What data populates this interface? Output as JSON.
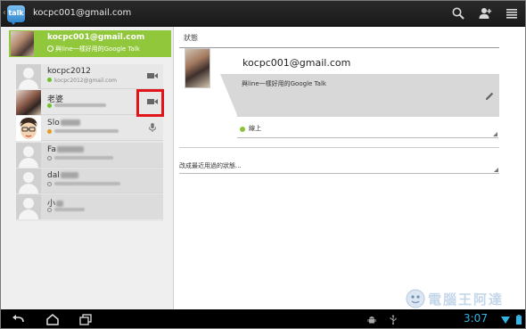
{
  "app": {
    "logo_text": "talk",
    "account_title": "kocpc001@gmail.com"
  },
  "self": {
    "email": "kocpc001@gmail.com",
    "status_message": "與line一樣好用的Google Talk"
  },
  "contacts": [
    {
      "name": "kocpc2012",
      "sub": "kocpc2012@gmail.com",
      "presence": "online",
      "action": "video-camera-icon"
    },
    {
      "name": "老婆",
      "sub": "",
      "presence": "online",
      "action": "video-camera-icon"
    },
    {
      "name": "Slo",
      "sub": "",
      "presence": "idle",
      "action": "microphone-icon"
    },
    {
      "name": "Fa",
      "sub": "",
      "presence": "offline",
      "action": ""
    },
    {
      "name": "dal",
      "sub": "",
      "presence": "offline",
      "action": ""
    },
    {
      "name": "小",
      "sub": "",
      "presence": "offline",
      "action": ""
    }
  ],
  "detail": {
    "heading": "狀態",
    "email": "kocpc001@gmail.com",
    "status_message": "與line一樣好用的Google Talk",
    "availability": "線上",
    "recent_status_label": "改成最近用過的狀態..."
  },
  "watermark": {
    "text": "電腦王阿達"
  },
  "system_bar": {
    "clock": "3:07"
  },
  "colors": {
    "accent_green": "#91c73a",
    "online": "#6fbf2a",
    "idle": "#e69a1e",
    "highlight_red": "#e1141b",
    "clock_blue": "#33b5e5"
  }
}
